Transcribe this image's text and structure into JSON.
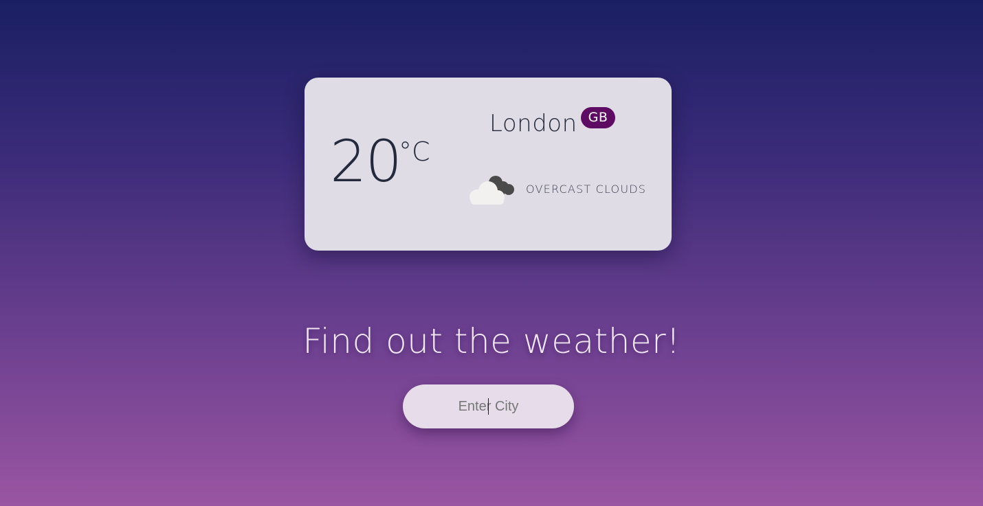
{
  "weather_card": {
    "temperature": "20",
    "unit": "°C",
    "city": "London",
    "country": "GB",
    "condition": "OVERCAST CLOUDS",
    "condition_icon": "overcast-clouds-icon"
  },
  "heading": "Find out the weather!",
  "search": {
    "placeholder": "Enter City",
    "value": ""
  },
  "colors": {
    "background_top": "#1a1f63",
    "background_bottom": "#9a55a2",
    "card_background": "#e0dce6",
    "badge": "#5e0b63",
    "text_dark": "#242a3d"
  }
}
